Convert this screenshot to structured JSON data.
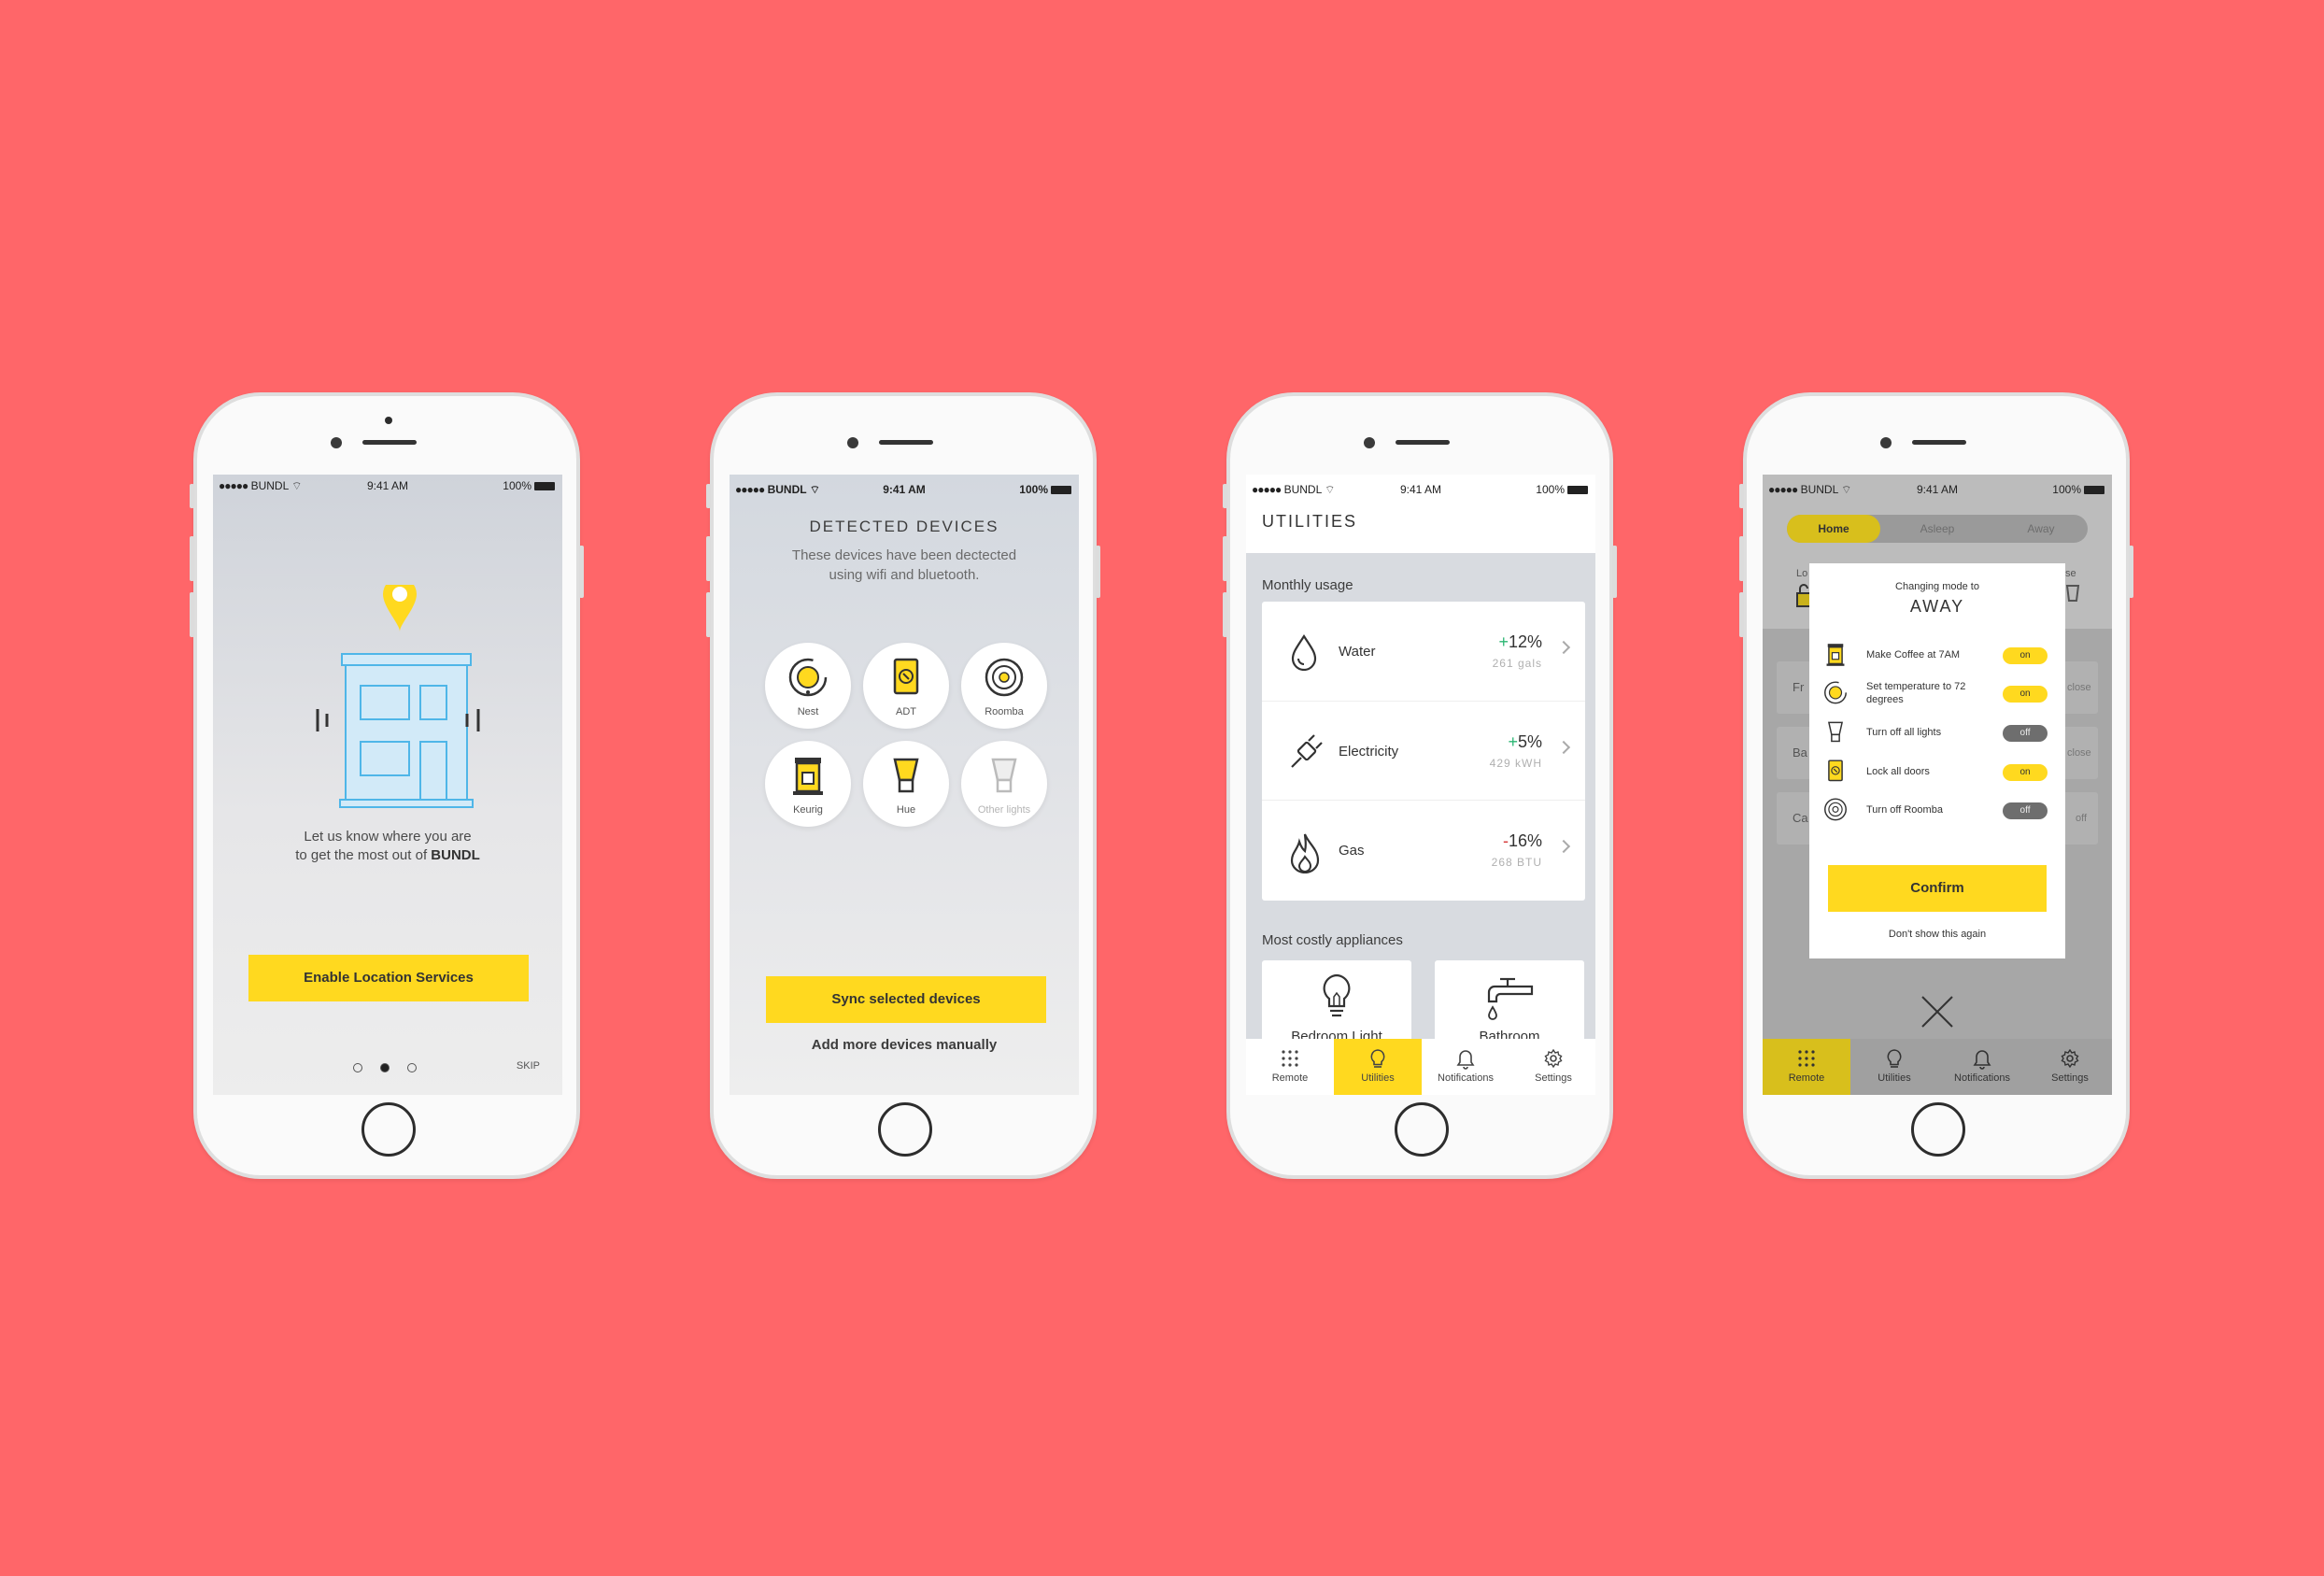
{
  "status": {
    "carrier": "BUNDL",
    "time": "9:41 AM",
    "battery": "100%"
  },
  "screen1": {
    "hint_line1": "Let us know where you are",
    "hint_line2_prefix": "to get the most out of ",
    "brand": "BUNDL",
    "enable_button": "Enable Location Services",
    "page_dots": [
      false,
      true,
      false
    ],
    "skip": "SKIP"
  },
  "screen2": {
    "title": "DETECTED DEVICES",
    "subtitle": "These devices have been dectected using wifi and bluetooth.",
    "devices": [
      {
        "label": "Nest",
        "icon": "nest-icon"
      },
      {
        "label": "ADT",
        "icon": "adt-icon"
      },
      {
        "label": "Roomba",
        "icon": "roomba-icon"
      },
      {
        "label": "Keurig",
        "icon": "keurig-icon"
      },
      {
        "label": "Hue",
        "icon": "hue-bulb-icon"
      },
      {
        "label": "Other lights",
        "icon": "light-bulb-icon"
      }
    ],
    "sync_button": "Sync selected devices",
    "manual_link": "Add more devices manually"
  },
  "screen3": {
    "title": "UTILITIES",
    "monthly_label": "Monthly usage",
    "utilities": [
      {
        "name": "Water",
        "sign": "+",
        "percent": "12%",
        "amount": "261 gals",
        "icon": "water-drop-icon"
      },
      {
        "name": "Electricity",
        "sign": "+",
        "percent": "5%",
        "amount": "429 kWH",
        "icon": "plug-icon"
      },
      {
        "name": "Gas",
        "sign": "-",
        "percent": "16%",
        "amount": "268 BTU",
        "icon": "flame-icon"
      }
    ],
    "costly_label": "Most costly appliances",
    "appliances": [
      {
        "name": "Bedroom Light",
        "icon": "light-bulb-icon"
      },
      {
        "name": "Bathroom",
        "icon": "faucet-icon"
      }
    ]
  },
  "tabs": [
    {
      "label": "Remote",
      "icon": "remote-grid-icon"
    },
    {
      "label": "Utilities",
      "icon": "bulb-icon"
    },
    {
      "label": "Notifications",
      "icon": "bell-icon"
    },
    {
      "label": "Settings",
      "icon": "gear-icon"
    }
  ],
  "screen4": {
    "modes": [
      "Home",
      "Asleep",
      "Away"
    ],
    "active_mode": "Home",
    "modal_pre": "Changing mode to",
    "modal_mode": "AWAY",
    "actions": [
      {
        "text": "Make Coffee at 7AM",
        "state": "on",
        "icon": "keurig-icon"
      },
      {
        "text": "Set temperature to 72 degrees",
        "state": "on",
        "icon": "nest-icon"
      },
      {
        "text": "Turn off all lights",
        "state": "off",
        "icon": "hue-bulb-icon"
      },
      {
        "text": "Lock all doors",
        "state": "on",
        "icon": "adt-icon"
      },
      {
        "text": "Turn off Roomba",
        "state": "off",
        "icon": "roomba-icon"
      }
    ],
    "confirm_button": "Confirm",
    "dont_show": "Don't show this again",
    "peek_texts": {
      "lo": "Lo",
      "se": "se",
      "fr": "Fr",
      "ba": "Ba",
      "ca": "Ca",
      "close1": "close",
      "close2": "close",
      "off": "off"
    }
  },
  "colors": {
    "background": "#FF6669",
    "accent": "#FFD91F",
    "positive": "#2bb673",
    "negative": "#d63b3b"
  }
}
